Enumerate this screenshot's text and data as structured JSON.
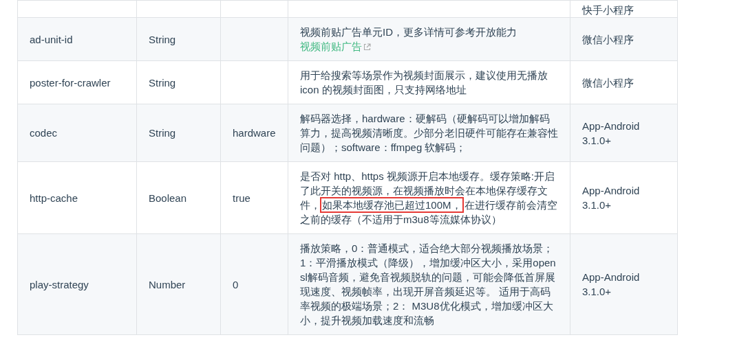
{
  "rows": [
    {
      "name": "",
      "type": "",
      "default": "",
      "description": [],
      "platform": "快手小程序"
    },
    {
      "name": "ad-unit-id",
      "type": "String",
      "default": "",
      "description": [
        {
          "kind": "text",
          "text": "视频前贴广告单元ID，更多详情可参考开放能力"
        },
        {
          "kind": "link",
          "text": "视频前贴广告"
        }
      ],
      "platform": "微信小程序"
    },
    {
      "name": "poster-for-crawler",
      "type": "String",
      "default": "",
      "description": [
        {
          "kind": "text",
          "text": "用于给搜索等场景作为视频封面展示，建议使用无播放 icon 的视频封面图，只支持网络地址"
        }
      ],
      "platform": "微信小程序"
    },
    {
      "name": "codec",
      "type": "String",
      "default": "hardware",
      "description": [
        {
          "kind": "text",
          "text": "解码器选择，hardware：硬解码（硬解码可以增加解码算力，提高视频清晰度。少部分老旧硬件可能存在兼容性问题）；software：ffmpeg 软解码；"
        }
      ],
      "platform": "App-Android 3.1.0+"
    },
    {
      "name": "http-cache",
      "type": "Boolean",
      "default": "true",
      "description": [
        {
          "kind": "text",
          "text": "是否对 http、https 视频源开启本地缓存。缓存策略:开启了此开关的视频源，在视频播放时会在本地保存缓存文件，"
        },
        {
          "kind": "boxed",
          "text": "如果本地缓存池已超过100M，"
        },
        {
          "kind": "text",
          "text": "在进行缓存前会清空之前的缓存（不适用于m3u8等流媒体协议）"
        }
      ],
      "platform": "App-Android 3.1.0+"
    },
    {
      "name": "play-strategy",
      "type": "Number",
      "default": "0",
      "description": [
        {
          "kind": "text",
          "text": "播放策略，0：普通模式，适合绝大部分视频播放场景；1：平滑播放模式（降级），增加缓冲区大小，采用open sl解码音频，避免音视频脱轨的问题，可能会降低首屏展现速度、视频帧率，出现开屏音频延迟等。 适用于高码率视频的极端场景；2： M3U8优化模式，增加缓冲区大小，提升视频加载速度和流畅"
        }
      ],
      "platform": "App-Android 3.1.0+"
    }
  ]
}
